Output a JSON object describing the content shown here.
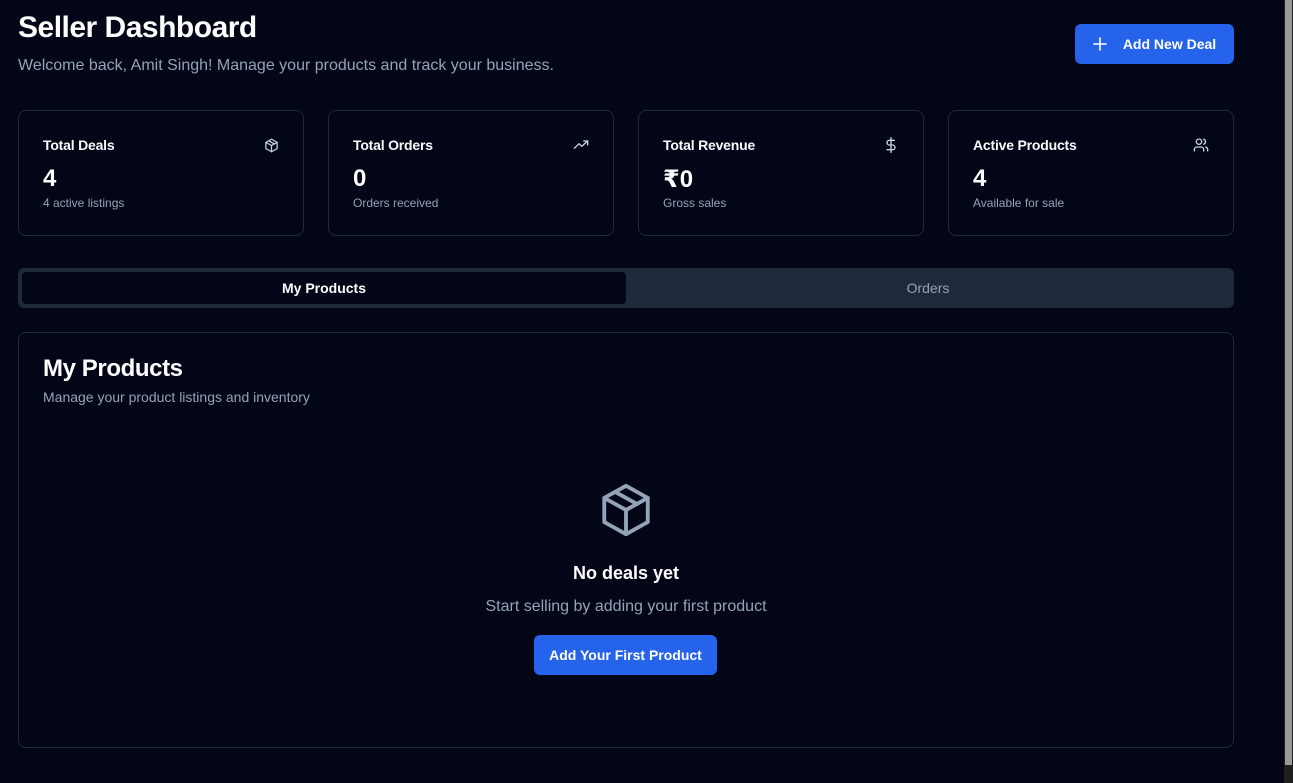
{
  "header": {
    "title": "Seller Dashboard",
    "subtitle": "Welcome back, Amit Singh! Manage your products and track your business.",
    "add_deal_label": "Add New Deal"
  },
  "stats": [
    {
      "label": "Total Deals",
      "value": "4",
      "caption": "4 active listings",
      "icon": "package-icon"
    },
    {
      "label": "Total Orders",
      "value": "0",
      "caption": "Orders received",
      "icon": "trending-up-icon"
    },
    {
      "label": "Total Revenue",
      "value": "₹0",
      "caption": "Gross sales",
      "icon": "dollar-icon"
    },
    {
      "label": "Active Products",
      "value": "4",
      "caption": "Available for sale",
      "icon": "users-icon"
    }
  ],
  "tabs": [
    {
      "label": "My Products",
      "active": true
    },
    {
      "label": "Orders",
      "active": false
    }
  ],
  "panel": {
    "title": "My Products",
    "subtitle": "Manage your product listings and inventory",
    "empty_title": "No deals yet",
    "empty_subtitle": "Start selling by adding your first product",
    "empty_button": "Add Your First Product"
  },
  "colors": {
    "background": "#020617",
    "accent": "#2563eb",
    "border": "#1e293b",
    "muted_text": "#94a3b8"
  }
}
